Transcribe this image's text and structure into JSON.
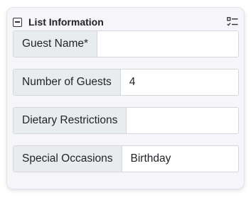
{
  "panel": {
    "title": "List Information",
    "collapse_icon": "minus-square-icon",
    "list_icon": "checklist-icon"
  },
  "fields": [
    {
      "label": "Guest Name*",
      "value": ""
    },
    {
      "label": "Number of Guests",
      "value": "4"
    },
    {
      "label": "Dietary Restrictions",
      "value": ""
    },
    {
      "label": "Special Occasions",
      "value": "Birthday"
    }
  ]
}
